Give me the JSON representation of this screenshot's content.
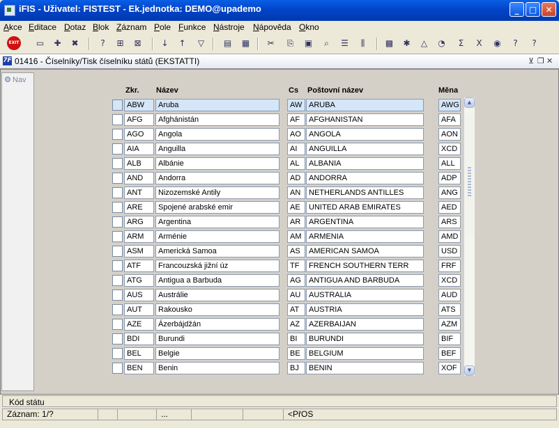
{
  "window": {
    "title": "iFIS - Uživatel: FISTEST - Ek.jednotka: DEMO@upademo"
  },
  "menu": [
    "Akce",
    "Editace",
    "Dotaz",
    "Blok",
    "Záznam",
    "Pole",
    "Funkce",
    "Nástroje",
    "Nápověda",
    "Okno"
  ],
  "toolbar": {
    "exit_label": "EXIT"
  },
  "form": {
    "title": "01416 - Číselníky/Tisk číselníku států (EKSTATTI)",
    "icon_label": "7F"
  },
  "nav": {
    "label": "Nav"
  },
  "columns": {
    "code": "Zkr.",
    "name": "Název",
    "cs": "Cs",
    "postal": "Poštovní název",
    "currency": "Měna"
  },
  "rows": [
    {
      "code": "ABW",
      "name": "Aruba",
      "cs": "AW",
      "postal": "ARUBA",
      "currency": "AWG"
    },
    {
      "code": "AFG",
      "name": "Afghánistán",
      "cs": "AF",
      "postal": "AFGHANISTAN",
      "currency": "AFA"
    },
    {
      "code": "AGO",
      "name": "Angola",
      "cs": "AO",
      "postal": "ANGOLA",
      "currency": "AON"
    },
    {
      "code": "AIA",
      "name": "Anguilla",
      "cs": "AI",
      "postal": "ANGUILLA",
      "currency": "XCD"
    },
    {
      "code": "ALB",
      "name": "Albánie",
      "cs": "AL",
      "postal": "ALBANIA",
      "currency": "ALL"
    },
    {
      "code": "AND",
      "name": "Andorra",
      "cs": "AD",
      "postal": "ANDORRA",
      "currency": "ADP"
    },
    {
      "code": "ANT",
      "name": "Nizozemské Antily",
      "cs": "AN",
      "postal": "NETHERLANDS ANTILLES",
      "currency": "ANG"
    },
    {
      "code": "ARE",
      "name": "Spojené arabské emir",
      "cs": "AE",
      "postal": "UNITED ARAB EMIRATES",
      "currency": "AED"
    },
    {
      "code": "ARG",
      "name": "Argentina",
      "cs": "AR",
      "postal": "ARGENTINA",
      "currency": "ARS"
    },
    {
      "code": "ARM",
      "name": "Arménie",
      "cs": "AM",
      "postal": "ARMENIA",
      "currency": "AMD"
    },
    {
      "code": "ASM",
      "name": "Americká Samoa",
      "cs": "AS",
      "postal": "AMERICAN SAMOA",
      "currency": "USD"
    },
    {
      "code": "ATF",
      "name": "Francouzská jižní úz",
      "cs": "TF",
      "postal": "FRENCH SOUTHERN TERR",
      "currency": "FRF"
    },
    {
      "code": "ATG",
      "name": "Antigua a Barbuda",
      "cs": "AG",
      "postal": "ANTIGUA AND BARBUDA",
      "currency": "XCD"
    },
    {
      "code": "AUS",
      "name": "Austrálie",
      "cs": "AU",
      "postal": "AUSTRALIA",
      "currency": "AUD"
    },
    {
      "code": "AUT",
      "name": "Rakousko",
      "cs": "AT",
      "postal": "AUSTRIA",
      "currency": "ATS"
    },
    {
      "code": "AZE",
      "name": "Ázerbájdžán",
      "cs": "AZ",
      "postal": "AZERBAIJAN",
      "currency": "AZM"
    },
    {
      "code": "BDI",
      "name": "Burundi",
      "cs": "BI",
      "postal": "BURUNDI",
      "currency": "BIF"
    },
    {
      "code": "BEL",
      "name": "Belgie",
      "cs": "BE",
      "postal": "BELGIUM",
      "currency": "BEF"
    },
    {
      "code": "BEN",
      "name": "Benin",
      "cs": "BJ",
      "postal": "BENIN",
      "currency": "XOF"
    }
  ],
  "status": {
    "field_hint": "Kód státu",
    "record": "Záznam: 1/?",
    "ellipsis": "...",
    "mode": "<PřOS"
  },
  "colors": {
    "title_bar": "#0A5FE6",
    "current_row": "#D4E6F8",
    "background": "#D4D0C8"
  }
}
